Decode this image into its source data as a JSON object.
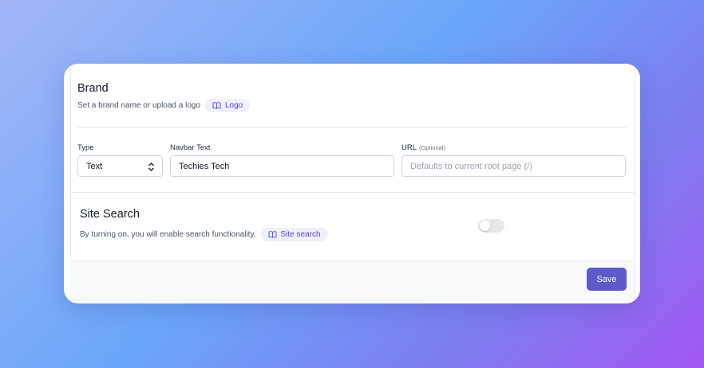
{
  "brand": {
    "title": "Brand",
    "description": "Set a brand name or upload a logo",
    "logo_pill": "Logo"
  },
  "fields": {
    "type_label": "Type",
    "type_value": "Text",
    "navbar_label": "Navbar Text",
    "navbar_value": "Techies Tech",
    "url_label": "URL",
    "url_optional": "(Optional)",
    "url_placeholder": "Defaults to current root page (/)"
  },
  "site_search": {
    "title": "Site Search",
    "description": "By turning on, you will enable search functionality.",
    "pill": "Site search",
    "enabled": false
  },
  "footer": {
    "save_label": "Save"
  },
  "colors": {
    "accent": "#5b5bc9",
    "pill_bg": "#eef0fc",
    "pill_text": "#4f46e5"
  },
  "icons": {
    "pill_icon": "book-open-icon",
    "select_icon": "chevron-up-down-icon"
  }
}
